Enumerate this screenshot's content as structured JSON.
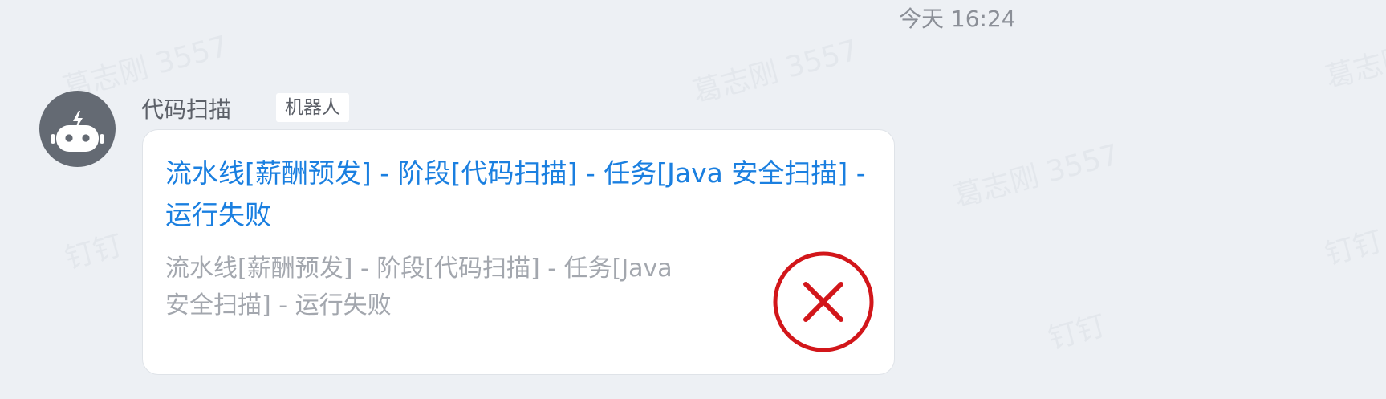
{
  "message": {
    "timestamp": "今天 16:24",
    "sender": {
      "name": "代码扫描",
      "tag": "机器人",
      "avatar_icon": "robot-icon"
    },
    "card": {
      "title": "流水线[薪酬预发] - 阶段[代码扫描] - 任务[Java 安全扫描] - 运行失败",
      "description": "流水线[薪酬预发] - 阶段[代码扫描] - 任务[Java 安全扫描] - 运行失败",
      "status_icon": "error-x-circle-icon"
    }
  },
  "colors": {
    "background": "#edf0f4",
    "title_link": "#1a7fe0",
    "description": "#a3a7ae",
    "error_red": "#d2161a",
    "avatar_bg": "#646a73"
  }
}
